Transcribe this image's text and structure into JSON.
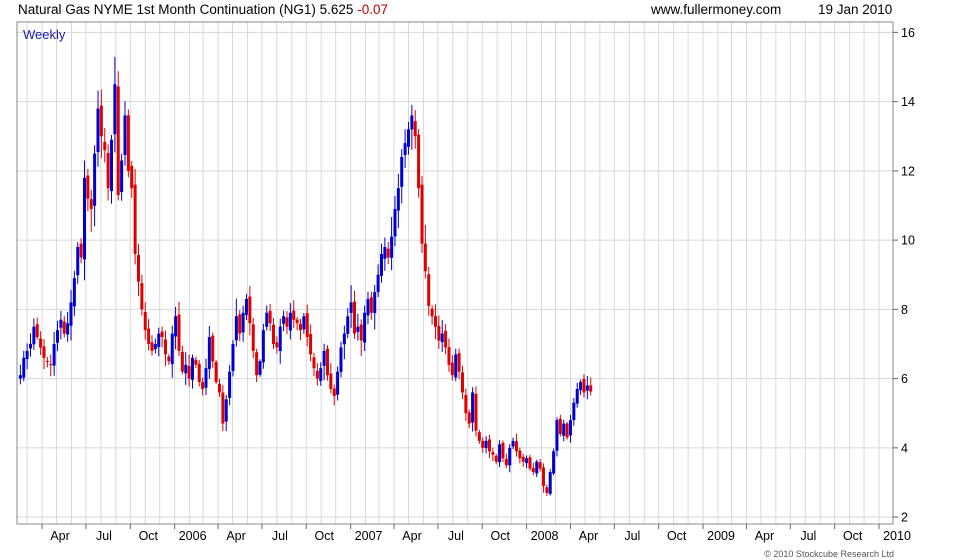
{
  "header": {
    "title": "Natural Gas NYME 1st Month Continuation (NG1)",
    "last": "5.625",
    "change": "-0.07",
    "site": "www.fullermoney.com",
    "date": "19 Jan 2010"
  },
  "period_label": "Weekly",
  "copyright": "© 2010 Stockcube Research Ltd",
  "colors": {
    "up": "#0000d0",
    "down": "#e00000",
    "grid": "#d8d8d8",
    "frame": "#888888"
  },
  "chart_data": {
    "type": "candlestick",
    "title": "Natural Gas NYME 1st Month Continuation (NG1)",
    "frequency": "weekly",
    "ylim": [
      1.8,
      16.3
    ],
    "yticks": [
      2,
      4,
      6,
      8,
      10,
      12,
      14,
      16
    ],
    "xlim": [
      "2005-02-08",
      "2010-01-30"
    ],
    "xticks": [
      {
        "label": "Apr",
        "date": "2005-04-01"
      },
      {
        "label": "Jul",
        "date": "2005-07-01"
      },
      {
        "label": "Oct",
        "date": "2005-10-01"
      },
      {
        "label": "2006",
        "date": "2006-01-01"
      },
      {
        "label": "Apr",
        "date": "2006-04-01"
      },
      {
        "label": "Jul",
        "date": "2006-07-01"
      },
      {
        "label": "Oct",
        "date": "2006-10-01"
      },
      {
        "label": "2007",
        "date": "2007-01-01"
      },
      {
        "label": "Apr",
        "date": "2007-04-01"
      },
      {
        "label": "Jul",
        "date": "2007-07-01"
      },
      {
        "label": "Oct",
        "date": "2007-10-01"
      },
      {
        "label": "2008",
        "date": "2008-01-01"
      },
      {
        "label": "Apr",
        "date": "2008-04-01"
      },
      {
        "label": "Jul",
        "date": "2008-07-01"
      },
      {
        "label": "Oct",
        "date": "2008-10-01"
      },
      {
        "label": "2009",
        "date": "2009-01-01"
      },
      {
        "label": "Apr",
        "date": "2009-04-01"
      },
      {
        "label": "Jul",
        "date": "2009-07-01"
      },
      {
        "label": "Oct",
        "date": "2009-10-01"
      },
      {
        "label": "2010",
        "date": "2010-01-01"
      }
    ],
    "grid": true,
    "series": [
      {
        "name": "NG1",
        "closes": [
          6.1,
          6.6,
          6.8,
          7.0,
          7.5,
          7.2,
          6.9,
          6.6,
          6.5,
          6.4,
          7.0,
          7.4,
          7.7,
          7.3,
          7.6,
          8.2,
          8.9,
          9.8,
          9.5,
          11.8,
          11.2,
          10.9,
          12.5,
          13.8,
          13.0,
          12.6,
          11.5,
          12.9,
          14.5,
          11.3,
          12.3,
          13.6,
          12.0,
          11.5,
          9.6,
          8.8,
          8.0,
          7.4,
          7.0,
          6.8,
          7.0,
          7.3,
          7.2,
          6.7,
          6.5,
          7.3,
          7.8,
          6.8,
          6.2,
          6.4,
          6.0,
          6.6,
          6.4,
          5.9,
          5.7,
          6.3,
          7.2,
          6.5,
          5.9,
          5.6,
          4.7,
          5.4,
          6.2,
          7.0,
          7.8,
          7.3,
          7.9,
          8.3,
          7.6,
          6.8,
          6.1,
          6.5,
          7.4,
          7.9,
          7.6,
          7.0,
          6.9,
          7.5,
          7.8,
          7.5,
          7.9,
          7.7,
          7.6,
          7.4,
          7.8,
          7.2,
          6.7,
          6.3,
          6.0,
          6.3,
          6.8,
          6.1,
          5.7,
          5.5,
          6.2,
          6.9,
          7.3,
          7.8,
          8.2,
          7.3,
          7.5,
          7.1,
          7.9,
          8.3,
          7.9,
          8.5,
          9.0,
          9.6,
          9.8,
          9.5,
          10.1,
          10.9,
          11.5,
          12.4,
          12.8,
          13.2,
          13.6,
          13.0,
          11.5,
          9.9,
          9.1,
          8.1,
          7.8,
          7.5,
          7.1,
          7.3,
          6.9,
          6.4,
          6.1,
          6.7,
          6.2,
          5.6,
          5.0,
          4.7,
          5.6,
          4.5,
          4.2,
          4.0,
          4.2,
          3.9,
          3.8,
          3.6,
          4.1,
          3.7,
          3.5,
          4.0,
          4.2,
          3.9,
          3.7,
          3.6,
          3.7,
          3.4,
          3.3,
          3.6,
          3.4,
          2.9,
          2.7,
          3.3,
          3.9,
          4.8,
          4.4,
          4.7,
          4.3,
          4.8,
          5.3,
          5.7,
          5.9,
          5.6,
          5.8,
          5.625
        ]
      }
    ]
  }
}
